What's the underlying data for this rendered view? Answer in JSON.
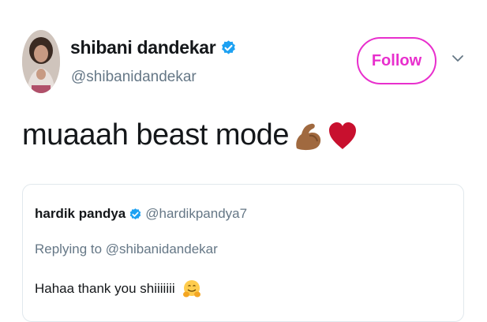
{
  "author": {
    "name": "shibani dandekar",
    "handle": "@shibanidandekar",
    "verified": true,
    "avatar_icon": "profile-photo"
  },
  "follow_label": "Follow",
  "accent_color": "#e82fcd",
  "menu_icon": "chevron-down-icon",
  "tweet": {
    "text": "muaaah beast mode",
    "emojis": [
      "flexed-biceps-icon",
      "red-heart-icon"
    ]
  },
  "quoted": {
    "name": "hardik pandya",
    "handle": "@hardikpandya7",
    "verified": true,
    "replying_to": "Replying to @shibanidandekar",
    "text": "Hahaa thank you shiiiiiii",
    "emoji": "hugging-face-icon"
  }
}
